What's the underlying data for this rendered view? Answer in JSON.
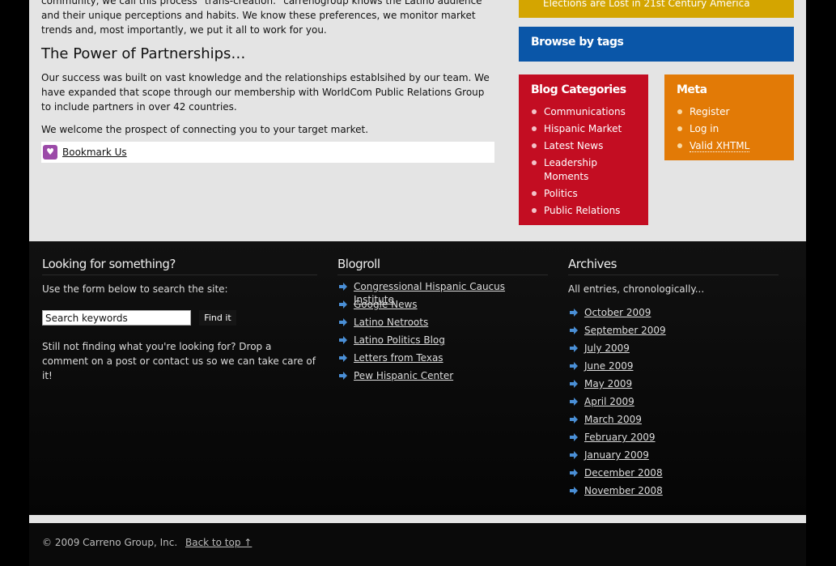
{
  "main": {
    "intro_text": "community, we call this process \"trans-creation.\" carrenogroup knows the Latino audience and their unique perceptions and habits. We know these preferences, we monitor market trends and, most importantly, we put it all to work for you.",
    "heading": "The Power of Partnerships…",
    "para1": "Our success was built on vast knowledge and the relationships establsihed by our team.   We have expanded that scope through our membership with WorldCom Public Relations Group to include partners in over 42 countries.",
    "para2": "We welcome the prospect of connecting you to your target market.",
    "bookmark_label": "Bookmark Us"
  },
  "sidebar": {
    "yellow_text": "Elections are Lost in 21st Century America",
    "browse_tags": "Browse by tags",
    "categories": {
      "title": "Blog Categories",
      "items": [
        "Communications",
        "Hispanic Market",
        "Latest News",
        "Leadership Moments",
        "Politics",
        "Public Relations"
      ]
    },
    "meta": {
      "title": "Meta",
      "items": [
        "Register",
        "Log in",
        "Valid XHTML"
      ]
    }
  },
  "footer_widgets": {
    "search": {
      "title": "Looking for something?",
      "note1": "Use the form below to search the site:",
      "placeholder": "Search keywords",
      "button": "Find it",
      "note2": "Still not finding what you're looking for? Drop a comment on a post or contact us so we can take care of it!"
    },
    "blogroll": {
      "title": "Blogroll",
      "items": [
        "Congressional Hispanic Caucus Institute",
        "Google News",
        "Latino Netroots",
        "Latino Politics Blog",
        "Letters from Texas",
        "Pew Hispanic Center"
      ]
    },
    "archives": {
      "title": "Archives",
      "note": "All entries, chronologically...",
      "items": [
        "October 2009",
        "September 2009",
        "July 2009",
        "June 2009",
        "May 2009",
        "April 2009",
        "March 2009",
        "February 2009",
        "January 2009",
        "December 2008",
        "November 2008"
      ]
    }
  },
  "footer": {
    "copyright": "© 2009 Carreno Group, Inc.",
    "back_to_top": "Back to top ↑"
  },
  "colors": {
    "yellow": "#d4a500",
    "blue": "#0a56a8",
    "red": "#c30d22",
    "orange": "#e27a06",
    "arrow": "#4a8fd6"
  }
}
